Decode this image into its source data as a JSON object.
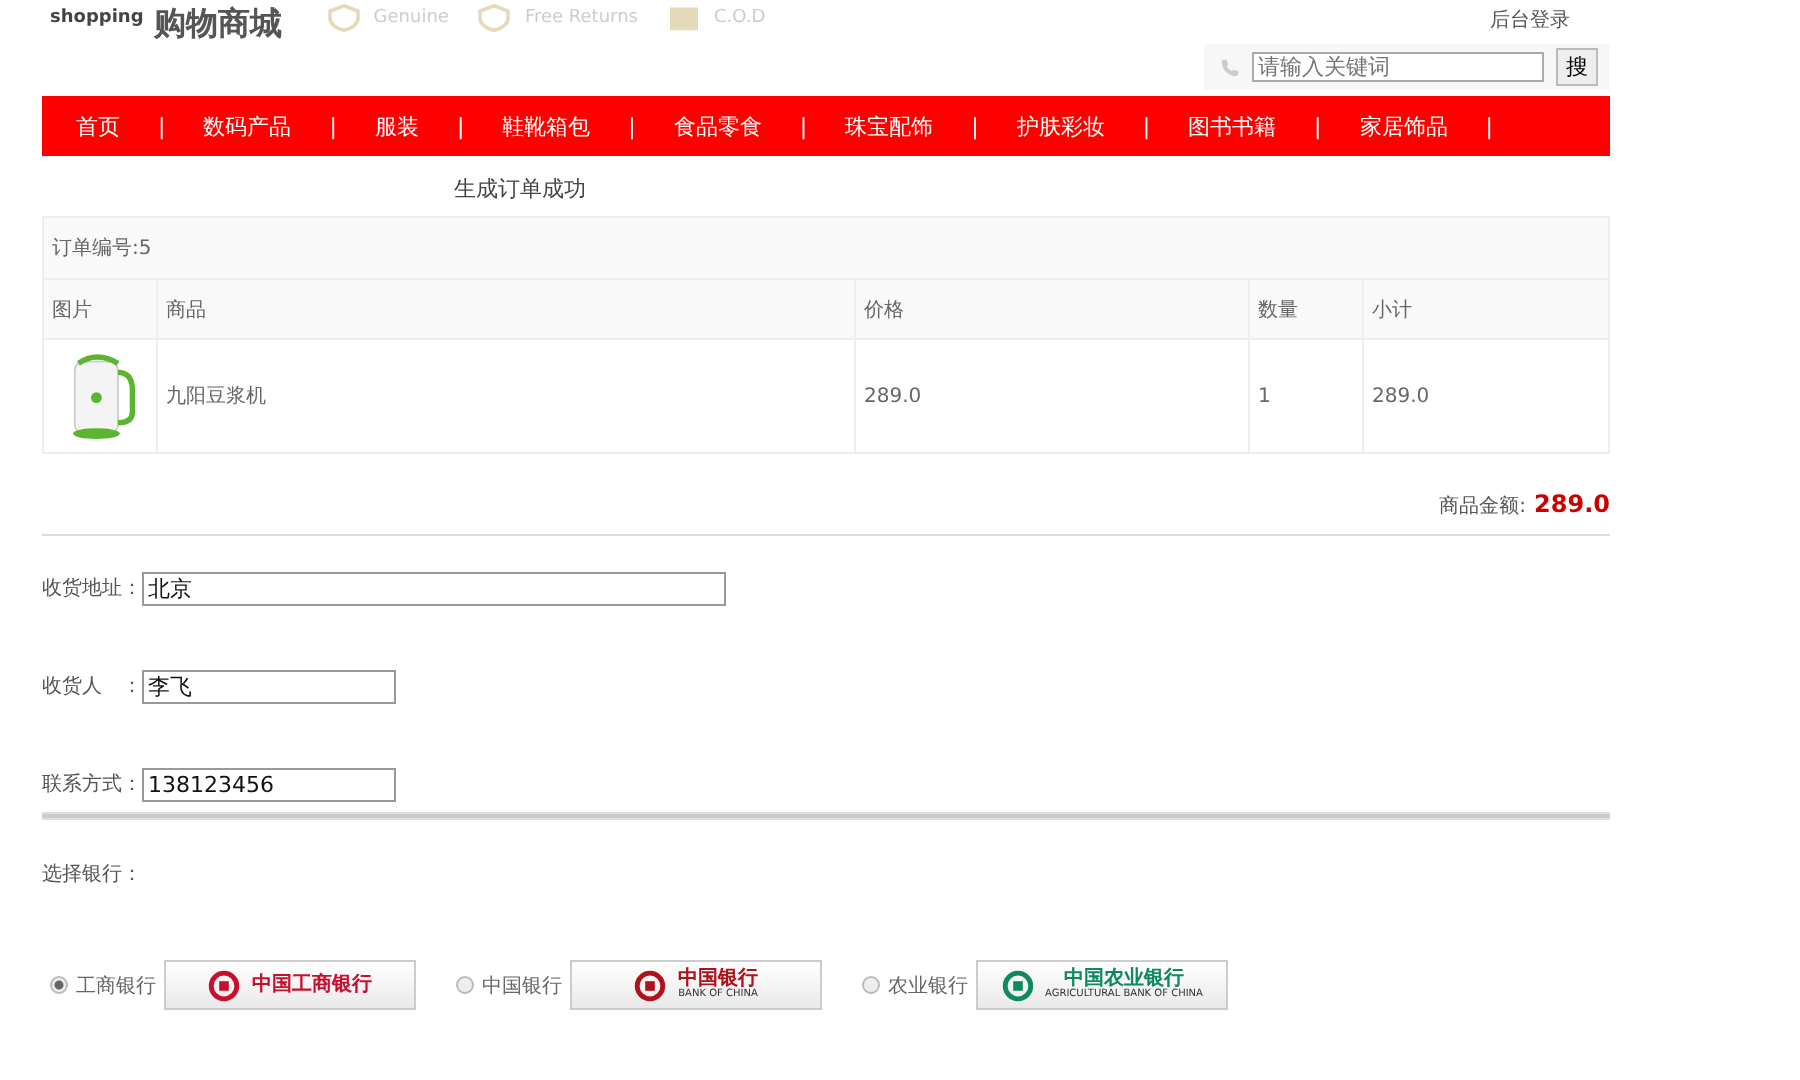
{
  "header": {
    "logo_small": "shopping",
    "logo_title": "购物商城",
    "badges": [
      {
        "kind": "shield",
        "label": "Genuine"
      },
      {
        "kind": "shield",
        "label": "Free Returns"
      },
      {
        "kind": "box",
        "label": "C.O.D"
      }
    ],
    "login_link": "后台登录",
    "search": {
      "placeholder": "请输入关键词",
      "button": "搜"
    }
  },
  "nav": {
    "separator": "|",
    "items": [
      {
        "label": "首页"
      },
      {
        "label": "数码产品"
      },
      {
        "label": "服装"
      },
      {
        "label": "鞋靴箱包"
      },
      {
        "label": "食品零食"
      },
      {
        "label": "珠宝配饰"
      },
      {
        "label": "护肤彩妆"
      },
      {
        "label": "图书书籍"
      },
      {
        "label": "家居饰品"
      }
    ]
  },
  "message": "生成订单成功",
  "order": {
    "number": "订单编号:5",
    "columns": [
      "图片",
      "商品",
      "价格",
      "数量",
      "小计"
    ],
    "rows": [
      {
        "name": "九阳豆浆机",
        "price": "289.0",
        "quantity": "1",
        "subtotal": "289.0"
      }
    ],
    "total_label": "商品金额:",
    "total": "289.0"
  },
  "form": [
    {
      "label": "收货地址：",
      "value": "北京",
      "kind": "long"
    },
    {
      "label": "收货人　：",
      "value": "李飞",
      "kind": "short"
    },
    {
      "label": "联系方式：",
      "value": "138123456",
      "kind": "short"
    }
  ],
  "bank_section": {
    "label": "选择银行：",
    "banks": [
      {
        "name": "工商银行",
        "selected": true,
        "logo_text": "中国工商银行",
        "color": "#c8102e"
      },
      {
        "name": "中国银行",
        "selected": false,
        "logo_text": "中国银行",
        "logo_subtext": "BANK OF CHINA",
        "color": "#b0121b"
      },
      {
        "name": "农业银行",
        "selected": false,
        "logo_text": "中国农业银行",
        "logo_subtext": "AGRICULTURAL BANK OF CHINA",
        "color": "#0f8a5f"
      }
    ]
  }
}
